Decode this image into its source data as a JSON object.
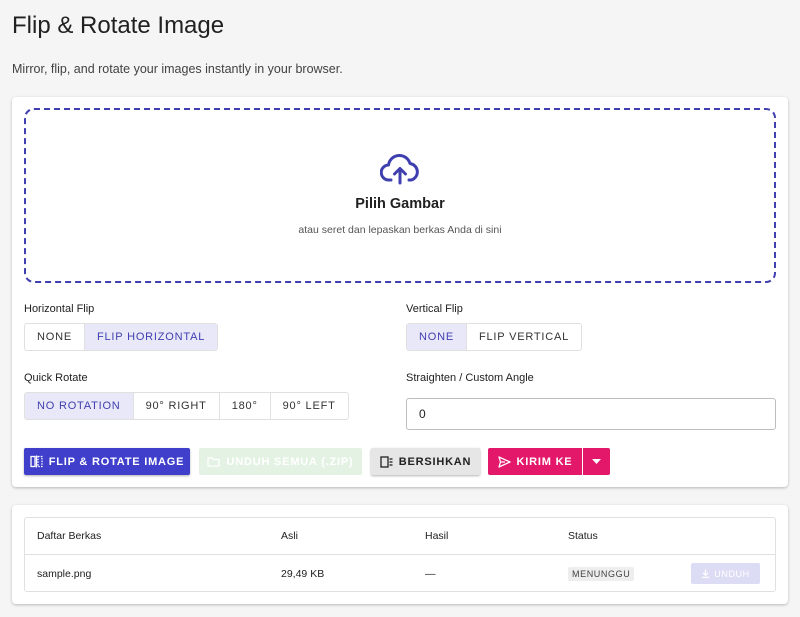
{
  "header": {
    "title": "Flip & Rotate Image",
    "subtitle": "Mirror, flip, and rotate your images instantly in your browser."
  },
  "dropzone": {
    "icon": "cloud-upload-icon",
    "title": "Pilih Gambar",
    "hint": "atau seret dan lepaskan berkas Anda di sini"
  },
  "horizontal_flip": {
    "label": "Horizontal Flip",
    "options": [
      "NONE",
      "FLIP HORIZONTAL"
    ],
    "selected": "FLIP HORIZONTAL"
  },
  "vertical_flip": {
    "label": "Vertical Flip",
    "options": [
      "NONE",
      "FLIP VERTICAL"
    ],
    "selected": "NONE"
  },
  "quick_rotate": {
    "label": "Quick Rotate",
    "options": [
      "NO ROTATION",
      "90° RIGHT",
      "180°",
      "90° LEFT"
    ],
    "selected": "NO ROTATION"
  },
  "custom_angle": {
    "label": "Straighten / Custom Angle",
    "value": "0"
  },
  "actions": {
    "process_label": "FLIP & ROTATE IMAGE",
    "download_all_label": "UNDUH SEMUA (.ZIP)",
    "clear_label": "BERSIHKAN",
    "send_label": "KIRIM KE"
  },
  "files": {
    "columns": [
      "Daftar Berkas",
      "Asli",
      "Hasil",
      "Status"
    ],
    "rows": [
      {
        "name": "sample.png",
        "original": "29,49 KB",
        "result": "—",
        "status": "MENUNGGU",
        "download_label": "UNDUH"
      }
    ]
  },
  "colors": {
    "accent": "#3f3fcc",
    "accent_soft": "#e8e8f8",
    "send": "#e3186b",
    "download_disabled": "#e4f2e4",
    "page_bg": "#f5f5f5"
  }
}
